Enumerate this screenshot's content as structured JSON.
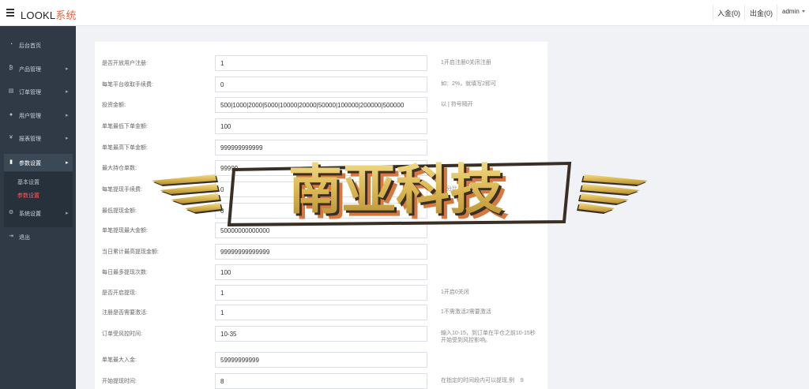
{
  "header": {
    "brand_prefix": "LOOKL",
    "brand_suffix": "系统",
    "deposit_label": "入金(0)",
    "withdraw_label": "出金(0)",
    "user_label": "admin"
  },
  "sidebar": {
    "items": [
      {
        "icon": "dashboard-icon",
        "glyph": "◔",
        "label": "后台首页",
        "has_arrow": false
      },
      {
        "icon": "bitcoin-icon",
        "glyph": "₿",
        "label": "产品管理",
        "has_arrow": true
      },
      {
        "icon": "orders-icon",
        "glyph": "▤",
        "label": "订单管理",
        "has_arrow": true
      },
      {
        "icon": "user-icon",
        "glyph": "●",
        "label": "用户管理",
        "has_arrow": true
      },
      {
        "icon": "yen-icon",
        "glyph": "¥",
        "label": "报表管理",
        "has_arrow": true
      },
      {
        "icon": "settings-folder-icon",
        "glyph": "▮",
        "label": "参数设置",
        "has_arrow": true,
        "active": true
      },
      {
        "icon": "gears-icon",
        "glyph": "⚙",
        "label": "系统设置",
        "has_arrow": true
      },
      {
        "icon": "logout-icon",
        "glyph": "⇥",
        "label": "退出",
        "has_arrow": false
      }
    ],
    "submenu": [
      {
        "label": "基本设置",
        "current": false
      },
      {
        "label": "参数设置",
        "current": true
      }
    ]
  },
  "form": {
    "rows": [
      {
        "label": "是否开放用户注册:",
        "value": "1",
        "hint": "1开启注册0关闭注册"
      },
      {
        "label": "每笔平台收取手续费:",
        "value": "0",
        "hint": "如：2%，就填写2即可"
      },
      {
        "label": "投资金额:",
        "value": "500|1000|2000|5000|10000|20000|50000|100000|200000|500000",
        "hint": "以 | 符号隔开"
      },
      {
        "label": "单笔最低下单金额:",
        "value": "100",
        "hint": ""
      },
      {
        "label": "单笔最高下单金额:",
        "value": "999999999999",
        "hint": ""
      },
      {
        "label": "最大持仓单数:",
        "value": "99999",
        "hint": ""
      },
      {
        "label": "每笔提现手续费:",
        "value": "0",
        "hint": "百分比,"
      },
      {
        "label": "最低提现金额:",
        "value": "0",
        "hint": ""
      },
      {
        "label": "单笔提现最大金额:",
        "value": "50000000000000",
        "hint": ""
      },
      {
        "label": "当日累计最高提现金额:",
        "value": "99999999999999",
        "hint": ""
      },
      {
        "label": "每日最多提现次数:",
        "value": "100",
        "hint": ""
      },
      {
        "label": "是否开启提现:",
        "value": "1",
        "hint": "1开启0关闭"
      },
      {
        "label": "注册是否需要激活:",
        "value": "1",
        "hint": "1不需激活2需要激活"
      },
      {
        "label": "订单受风控时间:",
        "value": "10-35",
        "hint": "输入10-15，到订单在平仓之前10-15秒\n开始受到风控影响。"
      },
      {
        "label": "单笔最大入金:",
        "value": "59999999999",
        "hint": ""
      },
      {
        "label": "开始提现时间:",
        "value": "8",
        "hint": "在指定的时间段内可以提现,例    9"
      }
    ]
  },
  "watermark": {
    "text": "南亚科技",
    "colors": {
      "gold": "#d9b650",
      "shadow": "#d9773f",
      "dark": "#3a2f25"
    }
  }
}
